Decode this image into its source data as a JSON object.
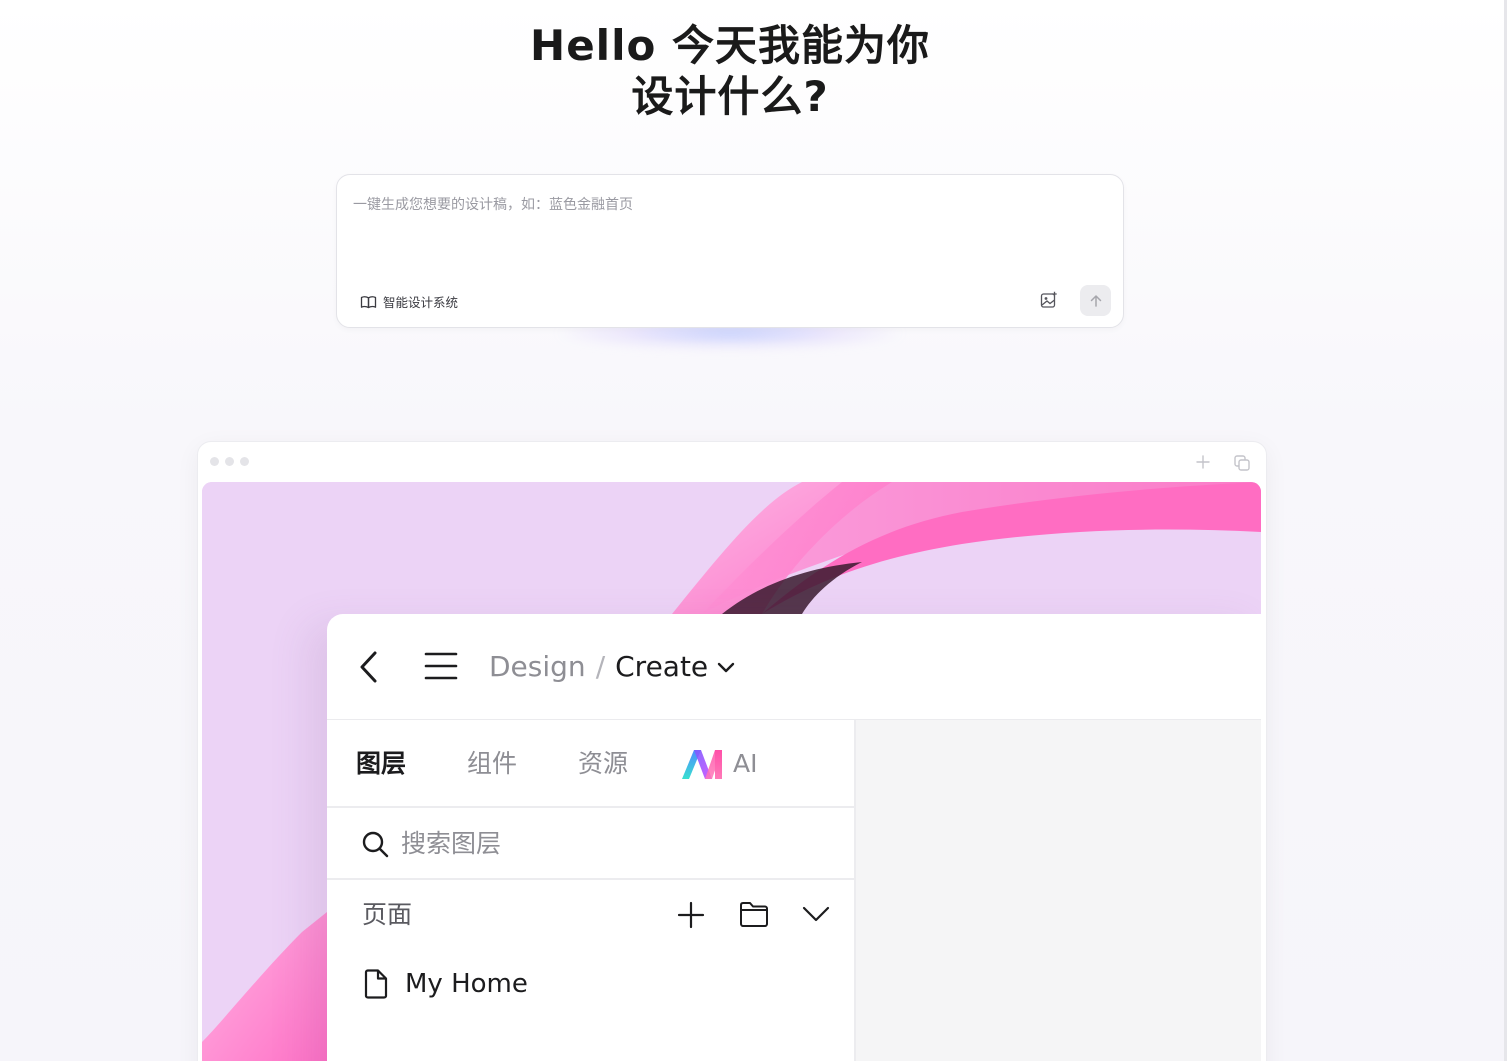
{
  "hero": {
    "title_line1": "Hello 今天我能为你",
    "title_line2": "设计什么?"
  },
  "prompt": {
    "placeholder": "一键生成您想要的设计稿，如：蓝色金融首页",
    "design_system_label": "智能设计系统",
    "image_upload_icon": "image-plus-icon",
    "send_icon": "arrow-up-icon"
  },
  "browser": {
    "toolbar_icons": [
      "plus-icon",
      "copy-icon"
    ]
  },
  "app": {
    "breadcrumb": {
      "parent": "Design",
      "separator": "/",
      "current": "Create"
    },
    "tabs": [
      {
        "label": "图层",
        "active": true
      },
      {
        "label": "组件",
        "active": false
      },
      {
        "label": "资源",
        "active": false
      },
      {
        "label": "AI",
        "active": false
      }
    ],
    "search": {
      "placeholder": "搜索图层",
      "value": ""
    },
    "pages": {
      "label": "页面",
      "items": [
        {
          "label": "My Home",
          "icon": "file-icon"
        }
      ]
    }
  },
  "colors": {
    "accent_pink": "#ff6fc3",
    "wallpaper_lavender": "#ecd3f6",
    "ai_logo_blue": "#4fb6ff",
    "ai_logo_purple": "#9a5cff",
    "ai_logo_pink": "#ff4fa8"
  }
}
